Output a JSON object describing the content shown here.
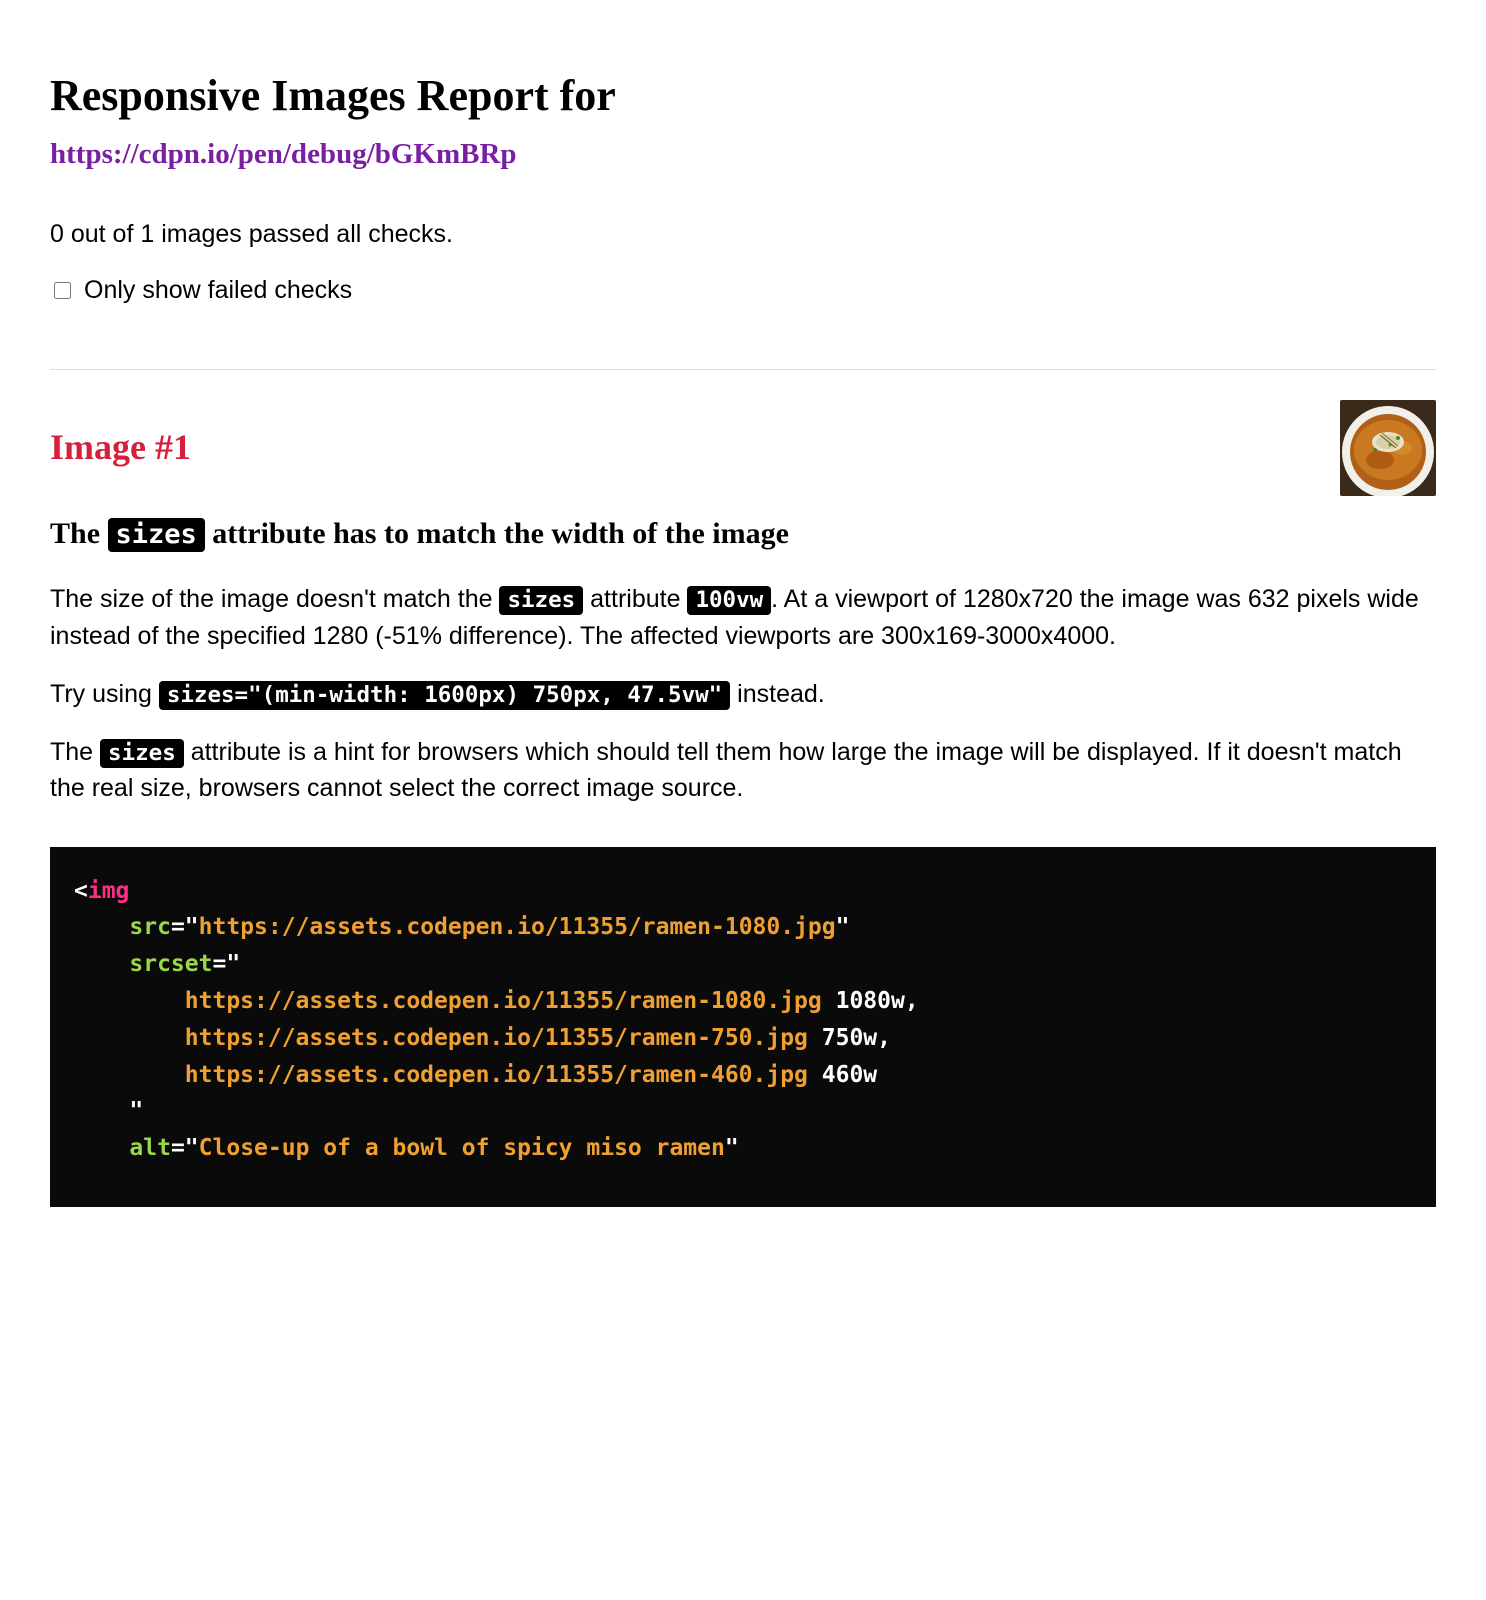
{
  "title": "Responsive Images Report for",
  "report_url": "https://cdpn.io/pen/debug/bGKmBRp",
  "summary": "0 out of 1 images passed all checks.",
  "filter": {
    "checked": false,
    "label": "Only show failed checks"
  },
  "image": {
    "heading": "Image #1",
    "check_title": {
      "pre": "The ",
      "code": "sizes",
      "post": " attribute has to match the width of the image"
    },
    "para1": {
      "t1": "The size of the image doesn't match the ",
      "c1": "sizes",
      "t2": " attribute ",
      "c2": "100vw",
      "t3": ". At a viewport of 1280x720 the image was 632 pixels wide instead of the specified 1280 (-51% difference). The affected viewports are 300x169-3000x4000."
    },
    "para2": {
      "t1": "Try using ",
      "c1": "sizes=\"(min-width: 1600px) 750px, 47.5vw\"",
      "t2": " instead."
    },
    "para3": {
      "t1": "The ",
      "c1": "sizes",
      "t2": " attribute is a hint for browsers which should tell them how large the image will be displayed. If it doesn't match the real size, browsers cannot select the correct image source."
    },
    "code": {
      "lt": "<",
      "tag": "img",
      "attr_src": "src",
      "eq": "=",
      "q": "\"",
      "src_val": "https://assets.codepen.io/11355/ramen-1080.jpg",
      "attr_srcset": "srcset",
      "srcset_l1_url": "https://assets.codepen.io/11355/ramen-1080.jpg",
      "srcset_l1_w": " 1080w,",
      "srcset_l2_url": "https://assets.codepen.io/11355/ramen-750.jpg",
      "srcset_l2_w": " 750w,",
      "srcset_l3_url": "https://assets.codepen.io/11355/ramen-460.jpg",
      "srcset_l3_w": " 460w",
      "attr_alt": "alt",
      "alt_val": "Close-up of a bowl of spicy miso ramen"
    }
  }
}
